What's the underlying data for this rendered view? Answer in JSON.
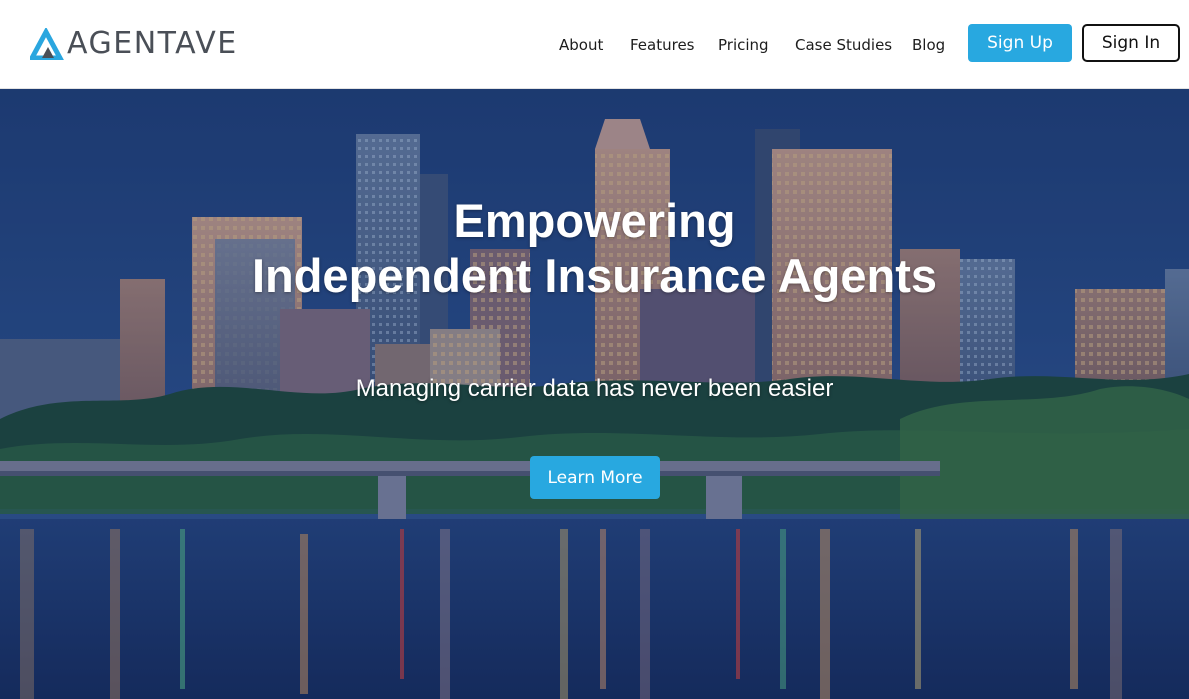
{
  "brand": {
    "name": "AGENTAVE",
    "logo_icon": "triangle-logo-icon",
    "accent": "#28a8e0",
    "dark": "#4a4f57"
  },
  "nav": {
    "items": [
      {
        "label": "About"
      },
      {
        "label": "Features"
      },
      {
        "label": "Pricing"
      },
      {
        "label": "Case Studies"
      },
      {
        "label": "Blog"
      }
    ],
    "signup_label": "Sign Up",
    "signin_label": "Sign In"
  },
  "hero": {
    "title_line1": "Empowering",
    "title_line2": "Independent Insurance Agents",
    "subtitle": "Managing carrier data has never been easier",
    "cta_label": "Learn More",
    "background": "city-skyline-night-image"
  }
}
